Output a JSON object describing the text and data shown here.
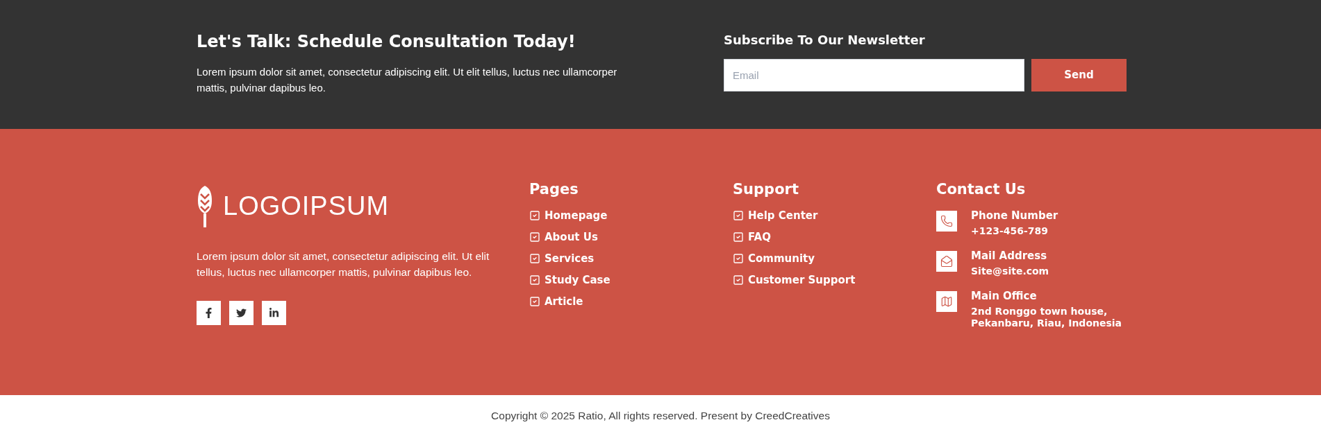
{
  "cta": {
    "title": "Let's Talk: Schedule Consultation Today!",
    "text": "Lorem ipsum dolor sit amet, consectetur adipiscing elit. Ut elit tellus, luctus nec ullamcorper mattis, pulvinar dapibus leo."
  },
  "newsletter": {
    "title": "Subscribe To Our Newsletter",
    "placeholder": "Email",
    "button": "Send"
  },
  "brand": {
    "logo": "LOGOIPSUM",
    "text": "Lorem ipsum dolor sit amet, consectetur adipiscing elit. Ut elit tellus, luctus nec ullamcorper mattis, pulvinar dapibus leo.",
    "social": [
      {
        "kind": "facebook"
      },
      {
        "kind": "twitter"
      },
      {
        "kind": "linkedin"
      }
    ]
  },
  "columns": [
    {
      "title": "Pages",
      "items": [
        "Homepage",
        "About Us",
        "Services",
        "Study Case",
        "Article"
      ]
    },
    {
      "title": "Support",
      "items": [
        "Help Center",
        "FAQ",
        "Community",
        "Customer Support"
      ]
    }
  ],
  "contact": {
    "title": "Contact Us",
    "items": [
      {
        "kind": "phone",
        "label": "Phone Number",
        "value": "+123-456-789"
      },
      {
        "kind": "mail",
        "label": "Mail Address",
        "value": "Site@site.com"
      },
      {
        "kind": "map",
        "label": "Main Office",
        "value": "2nd Ronggo town house, Pekanbaru, Riau, Indonesia"
      }
    ]
  },
  "copyright": "Copyright © 2025 Ratio, All rights reserved. Present by CreedCreatives"
}
